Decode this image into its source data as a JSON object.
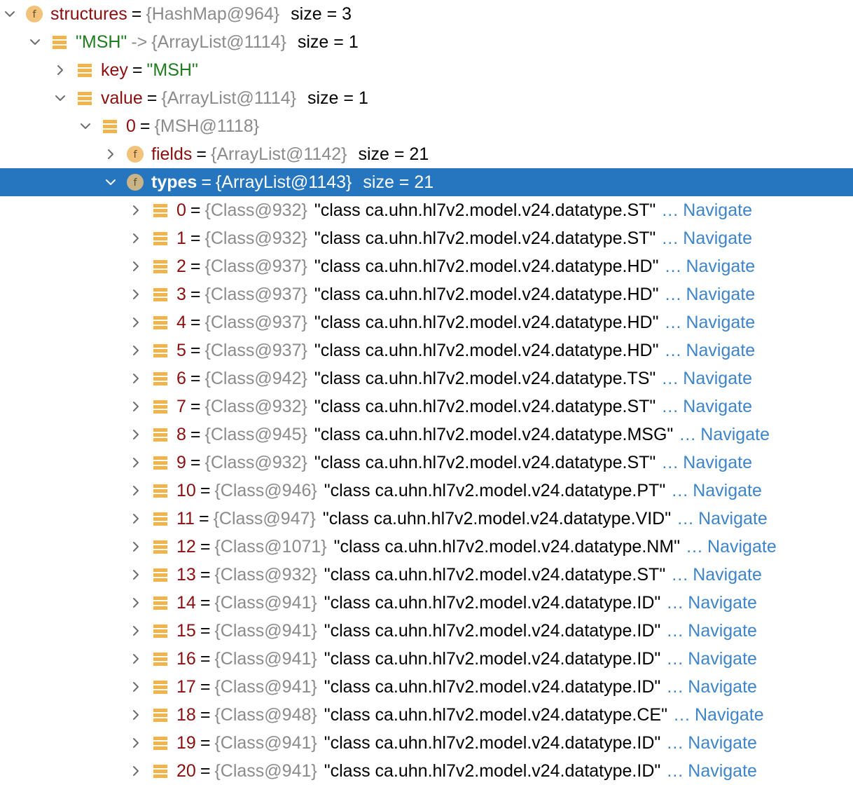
{
  "colors": {
    "selection": "#2675bf",
    "field_name": "#8b0f0f",
    "string_value": "#1f7d1f",
    "reference": "#8b8b8b",
    "navigate_link": "#3d84c9",
    "field_icon": "#f3c27a",
    "element_icon": "#f0b54a"
  },
  "tree": [
    {
      "depth": 0,
      "expanded": true,
      "icon": "field-icon",
      "name": "structures",
      "name_is_string": false,
      "arrow": "",
      "ref": "{HashMap@964}",
      "size": "size = 3",
      "value": "",
      "navigate": "",
      "selected": false
    },
    {
      "depth": 1,
      "expanded": true,
      "icon": "element-icon",
      "name": "\"MSH\"",
      "name_is_string": true,
      "arrow": "->",
      "ref": "{ArrayList@1114}",
      "size": "size = 1",
      "value": "",
      "navigate": "",
      "selected": false
    },
    {
      "depth": 2,
      "expanded": false,
      "icon": "element-icon",
      "name": "key",
      "name_is_string": false,
      "arrow": "",
      "ref": "\"MSH\"",
      "ref_is_string": true,
      "size": "",
      "value": "",
      "navigate": "",
      "selected": false
    },
    {
      "depth": 2,
      "expanded": true,
      "icon": "element-icon",
      "name": "value",
      "name_is_string": false,
      "arrow": "",
      "ref": "{ArrayList@1114}",
      "size": "size = 1",
      "value": "",
      "navigate": "",
      "selected": false
    },
    {
      "depth": 3,
      "expanded": true,
      "icon": "element-icon",
      "name": "0",
      "name_is_string": false,
      "arrow": "",
      "ref": "{MSH@1118}",
      "size": "",
      "value": "",
      "navigate": "",
      "selected": false
    },
    {
      "depth": 4,
      "expanded": false,
      "icon": "field-icon",
      "name": "fields",
      "name_is_string": false,
      "arrow": "",
      "ref": "{ArrayList@1142}",
      "size": "size = 21",
      "value": "",
      "navigate": "",
      "selected": false
    },
    {
      "depth": 4,
      "expanded": true,
      "icon": "field-icon",
      "name": "types",
      "name_is_string": false,
      "arrow": "",
      "ref": "{ArrayList@1143}",
      "size": "size = 21",
      "value": "",
      "navigate": "",
      "selected": true
    },
    {
      "depth": 5,
      "expanded": false,
      "icon": "element-icon",
      "name": "0",
      "arrow": "",
      "ref": "{Class@932}",
      "size": "",
      "value": "\"class ca.uhn.hl7v2.model.v24.datatype.ST\"",
      "navigate": "Navigate",
      "selected": false
    },
    {
      "depth": 5,
      "expanded": false,
      "icon": "element-icon",
      "name": "1",
      "arrow": "",
      "ref": "{Class@932}",
      "size": "",
      "value": "\"class ca.uhn.hl7v2.model.v24.datatype.ST\"",
      "navigate": "Navigate",
      "selected": false
    },
    {
      "depth": 5,
      "expanded": false,
      "icon": "element-icon",
      "name": "2",
      "arrow": "",
      "ref": "{Class@937}",
      "size": "",
      "value": "\"class ca.uhn.hl7v2.model.v24.datatype.HD\"",
      "navigate": "Navigate",
      "selected": false
    },
    {
      "depth": 5,
      "expanded": false,
      "icon": "element-icon",
      "name": "3",
      "arrow": "",
      "ref": "{Class@937}",
      "size": "",
      "value": "\"class ca.uhn.hl7v2.model.v24.datatype.HD\"",
      "navigate": "Navigate",
      "selected": false
    },
    {
      "depth": 5,
      "expanded": false,
      "icon": "element-icon",
      "name": "4",
      "arrow": "",
      "ref": "{Class@937}",
      "size": "",
      "value": "\"class ca.uhn.hl7v2.model.v24.datatype.HD\"",
      "navigate": "Navigate",
      "selected": false
    },
    {
      "depth": 5,
      "expanded": false,
      "icon": "element-icon",
      "name": "5",
      "arrow": "",
      "ref": "{Class@937}",
      "size": "",
      "value": "\"class ca.uhn.hl7v2.model.v24.datatype.HD\"",
      "navigate": "Navigate",
      "selected": false
    },
    {
      "depth": 5,
      "expanded": false,
      "icon": "element-icon",
      "name": "6",
      "arrow": "",
      "ref": "{Class@942}",
      "size": "",
      "value": "\"class ca.uhn.hl7v2.model.v24.datatype.TS\"",
      "navigate": "Navigate",
      "selected": false
    },
    {
      "depth": 5,
      "expanded": false,
      "icon": "element-icon",
      "name": "7",
      "arrow": "",
      "ref": "{Class@932}",
      "size": "",
      "value": "\"class ca.uhn.hl7v2.model.v24.datatype.ST\"",
      "navigate": "Navigate",
      "selected": false
    },
    {
      "depth": 5,
      "expanded": false,
      "icon": "element-icon",
      "name": "8",
      "arrow": "",
      "ref": "{Class@945}",
      "size": "",
      "value": "\"class ca.uhn.hl7v2.model.v24.datatype.MSG\"",
      "navigate": "Navigate",
      "selected": false
    },
    {
      "depth": 5,
      "expanded": false,
      "icon": "element-icon",
      "name": "9",
      "arrow": "",
      "ref": "{Class@932}",
      "size": "",
      "value": "\"class ca.uhn.hl7v2.model.v24.datatype.ST\"",
      "navigate": "Navigate",
      "selected": false
    },
    {
      "depth": 5,
      "expanded": false,
      "icon": "element-icon",
      "name": "10",
      "arrow": "",
      "ref": "{Class@946}",
      "size": "",
      "value": "\"class ca.uhn.hl7v2.model.v24.datatype.PT\"",
      "navigate": "Navigate",
      "selected": false
    },
    {
      "depth": 5,
      "expanded": false,
      "icon": "element-icon",
      "name": "11",
      "arrow": "",
      "ref": "{Class@947}",
      "size": "",
      "value": "\"class ca.uhn.hl7v2.model.v24.datatype.VID\"",
      "navigate": "Navigate",
      "selected": false
    },
    {
      "depth": 5,
      "expanded": false,
      "icon": "element-icon",
      "name": "12",
      "arrow": "",
      "ref": "{Class@1071}",
      "size": "",
      "value": "\"class ca.uhn.hl7v2.model.v24.datatype.NM\"",
      "navigate": "Navigate",
      "selected": false
    },
    {
      "depth": 5,
      "expanded": false,
      "icon": "element-icon",
      "name": "13",
      "arrow": "",
      "ref": "{Class@932}",
      "size": "",
      "value": "\"class ca.uhn.hl7v2.model.v24.datatype.ST\"",
      "navigate": "Navigate",
      "selected": false
    },
    {
      "depth": 5,
      "expanded": false,
      "icon": "element-icon",
      "name": "14",
      "arrow": "",
      "ref": "{Class@941}",
      "size": "",
      "value": "\"class ca.uhn.hl7v2.model.v24.datatype.ID\"",
      "navigate": "Navigate",
      "selected": false
    },
    {
      "depth": 5,
      "expanded": false,
      "icon": "element-icon",
      "name": "15",
      "arrow": "",
      "ref": "{Class@941}",
      "size": "",
      "value": "\"class ca.uhn.hl7v2.model.v24.datatype.ID\"",
      "navigate": "Navigate",
      "selected": false
    },
    {
      "depth": 5,
      "expanded": false,
      "icon": "element-icon",
      "name": "16",
      "arrow": "",
      "ref": "{Class@941}",
      "size": "",
      "value": "\"class ca.uhn.hl7v2.model.v24.datatype.ID\"",
      "navigate": "Navigate",
      "selected": false
    },
    {
      "depth": 5,
      "expanded": false,
      "icon": "element-icon",
      "name": "17",
      "arrow": "",
      "ref": "{Class@941}",
      "size": "",
      "value": "\"class ca.uhn.hl7v2.model.v24.datatype.ID\"",
      "navigate": "Navigate",
      "selected": false
    },
    {
      "depth": 5,
      "expanded": false,
      "icon": "element-icon",
      "name": "18",
      "arrow": "",
      "ref": "{Class@948}",
      "size": "",
      "value": "\"class ca.uhn.hl7v2.model.v24.datatype.CE\"",
      "navigate": "Navigate",
      "selected": false
    },
    {
      "depth": 5,
      "expanded": false,
      "icon": "element-icon",
      "name": "19",
      "arrow": "",
      "ref": "{Class@941}",
      "size": "",
      "value": "\"class ca.uhn.hl7v2.model.v24.datatype.ID\"",
      "navigate": "Navigate",
      "selected": false
    },
    {
      "depth": 5,
      "expanded": false,
      "icon": "element-icon",
      "name": "20",
      "arrow": "",
      "ref": "{Class@941}",
      "size": "",
      "value": "\"class ca.uhn.hl7v2.model.v24.datatype.ID\"",
      "navigate": "Navigate",
      "selected": false
    }
  ]
}
